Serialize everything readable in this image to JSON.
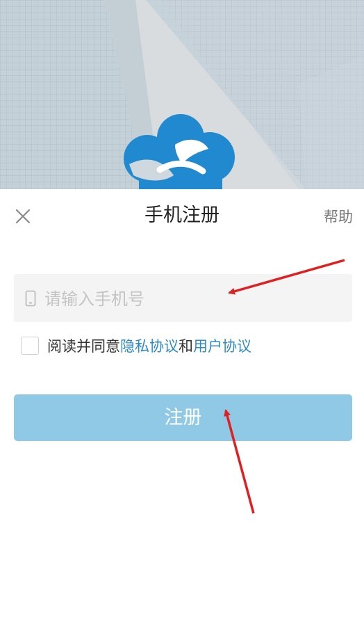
{
  "header": {
    "title": "手机注册",
    "help_label": "帮助"
  },
  "form": {
    "phone_placeholder": "请输入手机号",
    "agreement": {
      "prefix": "阅读并同意",
      "privacy_link": "隐私协议",
      "conjunction": "和",
      "terms_link": "用户协议"
    },
    "submit_label": "注册"
  },
  "icons": {
    "close": "close-icon",
    "phone": "phone-icon",
    "logo": "cloud-logo-icon"
  },
  "colors": {
    "accent": "#2e8bc9",
    "button": "#90c9e5",
    "annotation": "#e02020"
  }
}
